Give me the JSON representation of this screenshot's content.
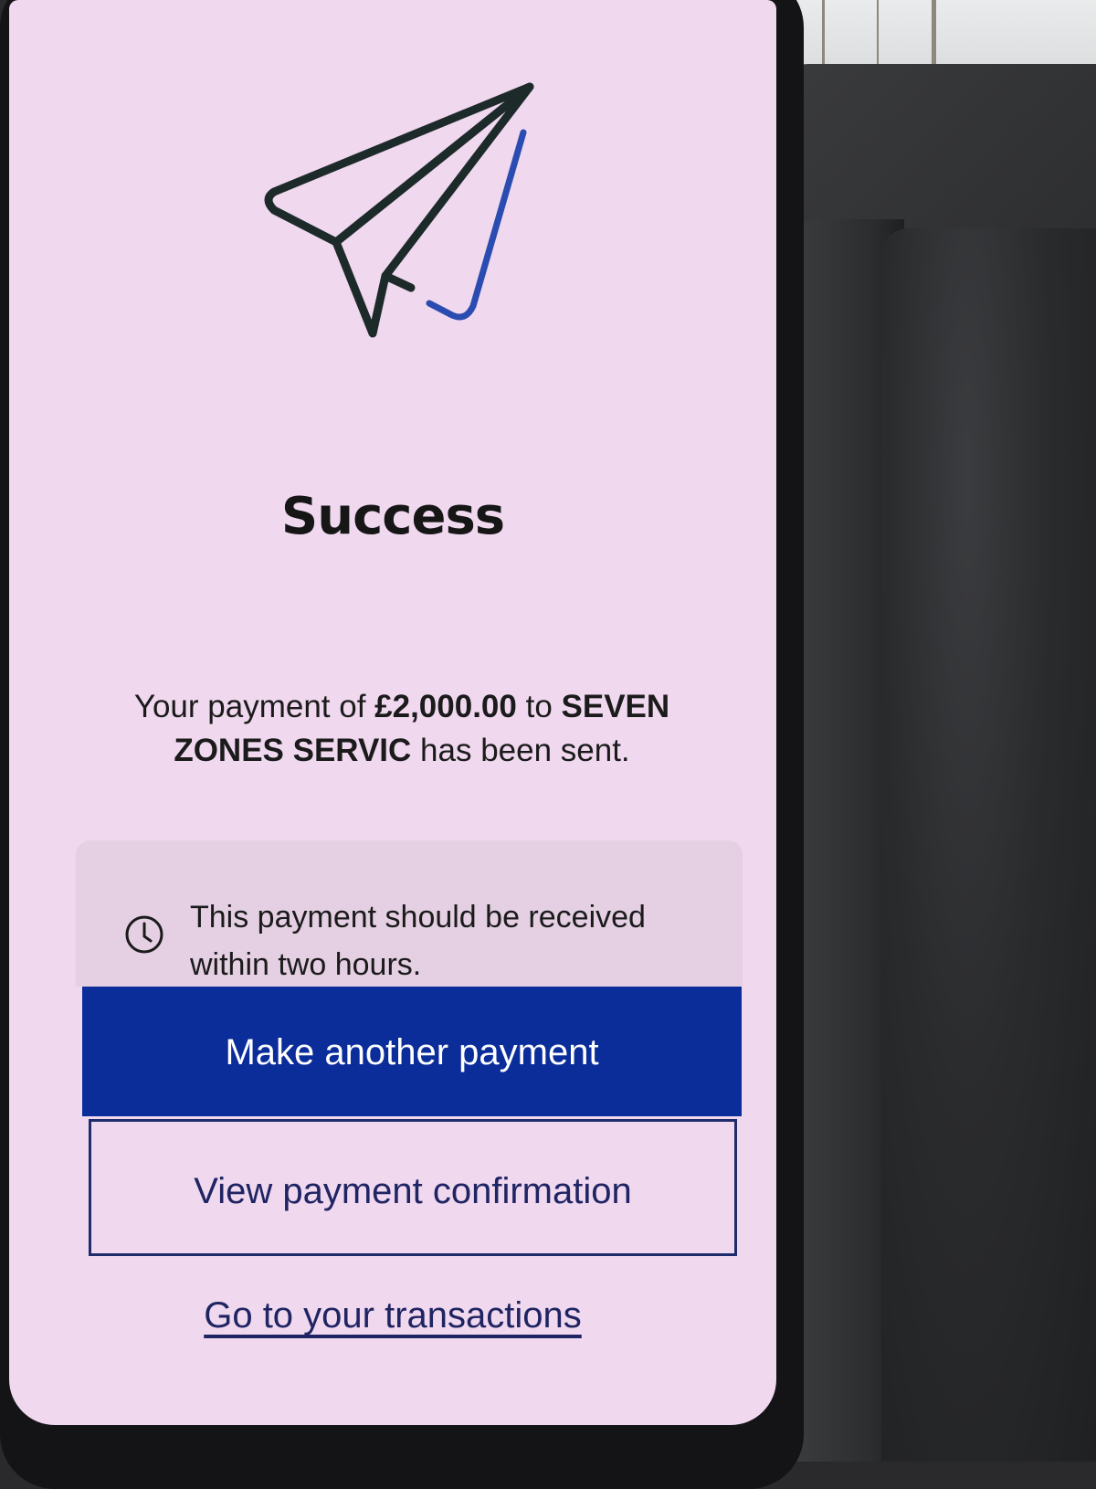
{
  "screen": {
    "title": "Success",
    "message": {
      "prefix": "Your payment of ",
      "amount": "£2,000.00",
      "middle": " to ",
      "payee": "SEVEN ZONES SERVIC",
      "suffix": " has been sent."
    },
    "info": {
      "text": "This payment should be received within two hours.",
      "icon": "clock-icon"
    },
    "primary_button": "Make another payment",
    "secondary_button": "View payment confirmation",
    "link": "Go to your transactions"
  },
  "colors": {
    "screen_background": "#f0d8ef",
    "primary_button": "#0b2d9a",
    "secondary_border": "#1f2c6b",
    "link_text": "#1f2462",
    "plane_stroke": "#1d2a2a",
    "plane_accent": "#2a4cb0"
  }
}
